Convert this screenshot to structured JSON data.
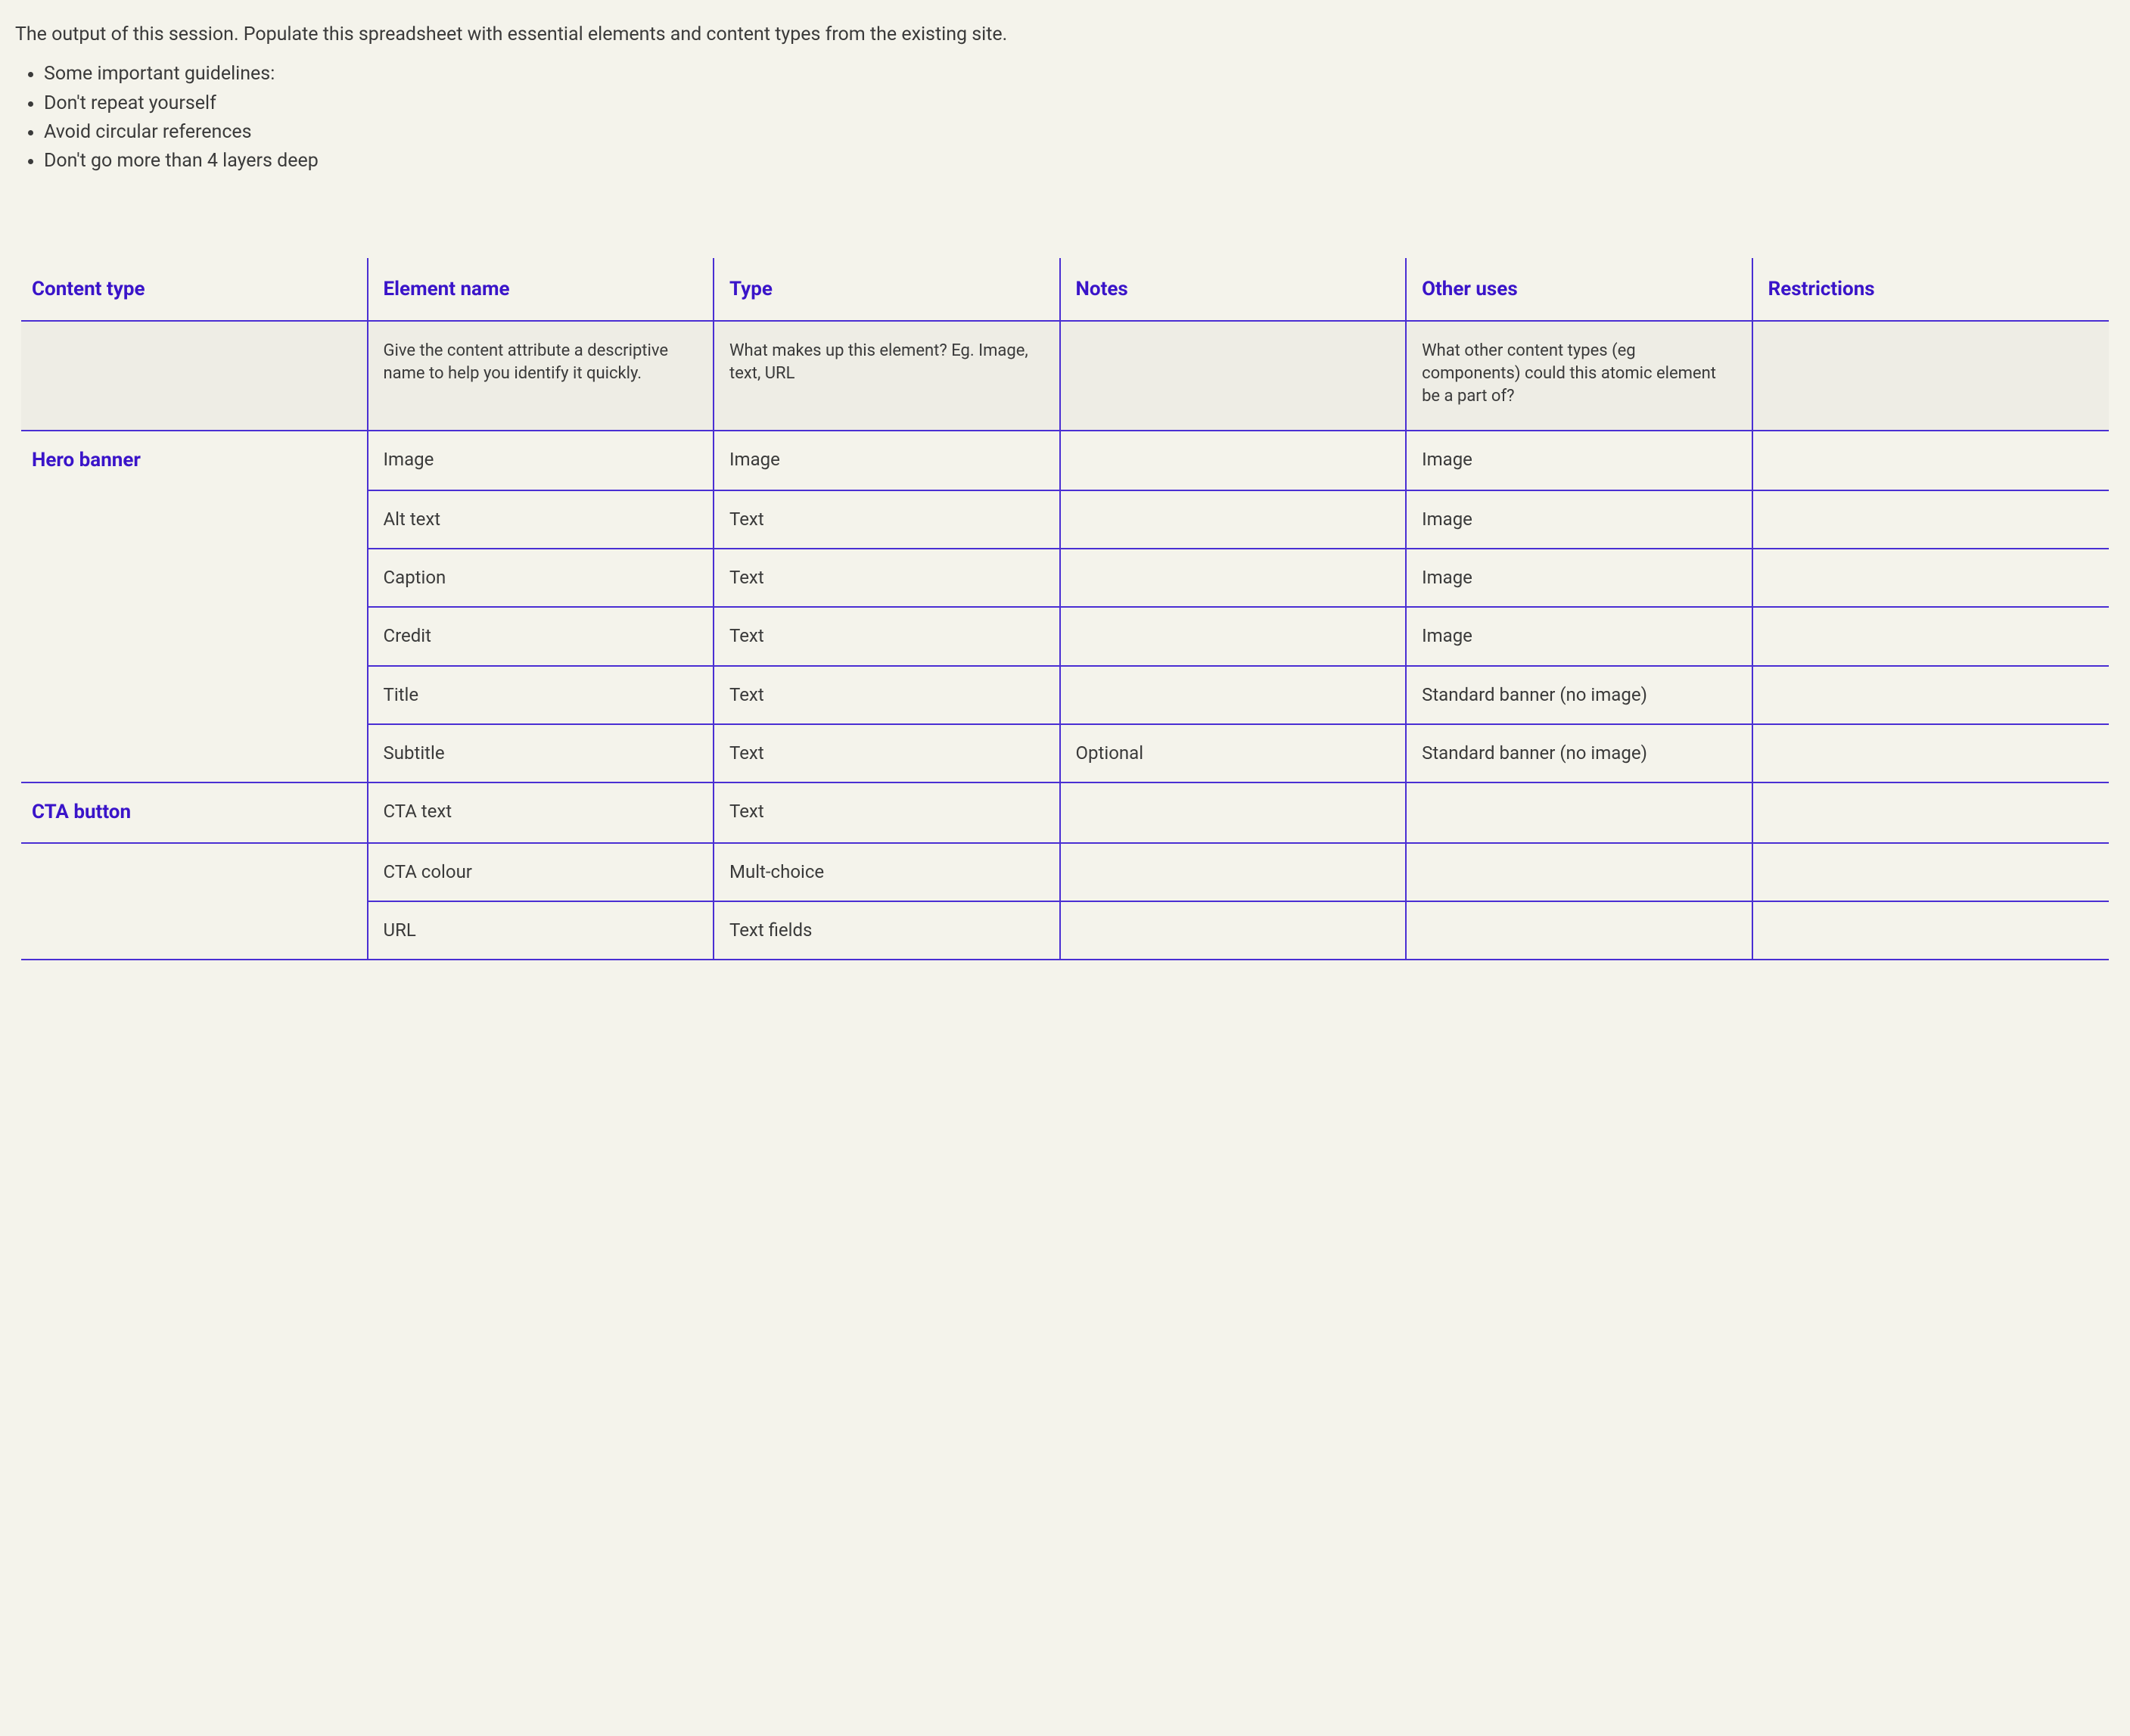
{
  "intro": "The output of this session. Populate this spreadsheet with essential elements and content types from the existing site.",
  "guidelines": [
    "Some important guidelines:",
    "Don't repeat yourself",
    "Avoid circular references",
    "Don't go more than 4 layers deep"
  ],
  "headers": {
    "content_type": "Content type",
    "element_name": "Element name",
    "type": "Type",
    "notes": "Notes",
    "other_uses": "Other uses",
    "restrictions": "Restrictions"
  },
  "descriptions": {
    "content_type": "",
    "element_name": "Give the content attribute a descriptive name to help you identify it quickly.",
    "type": "What makes up this element? Eg. Image, text, URL",
    "notes": "",
    "other_uses": "What other content types (eg components) could this atomic element be a part of?",
    "restrictions": ""
  },
  "groups": [
    {
      "label": "Hero banner",
      "rows": [
        {
          "element_name": "Image",
          "type": "Image",
          "notes": "",
          "other_uses": "Image",
          "restrictions": ""
        },
        {
          "element_name": "Alt text",
          "type": "Text",
          "notes": "",
          "other_uses": "Image",
          "restrictions": ""
        },
        {
          "element_name": "Caption",
          "type": "Text",
          "notes": "",
          "other_uses": "Image",
          "restrictions": ""
        },
        {
          "element_name": "Credit",
          "type": "Text",
          "notes": "",
          "other_uses": "Image",
          "restrictions": ""
        },
        {
          "element_name": "Title",
          "type": "Text",
          "notes": "",
          "other_uses": "Standard banner (no image)",
          "restrictions": ""
        },
        {
          "element_name": "Subtitle",
          "type": "Text",
          "notes": "Optional",
          "other_uses": "Standard banner (no image)",
          "restrictions": ""
        }
      ]
    },
    {
      "label": "CTA button",
      "rows": [
        {
          "element_name": "CTA text",
          "type": "Text",
          "notes": "",
          "other_uses": "",
          "restrictions": ""
        },
        {
          "element_name": "CTA colour",
          "type": "Mult-choice",
          "notes": "",
          "other_uses": "",
          "restrictions": ""
        },
        {
          "element_name": "URL",
          "type": "Text fields",
          "notes": "",
          "other_uses": "",
          "restrictions": ""
        }
      ]
    }
  ]
}
